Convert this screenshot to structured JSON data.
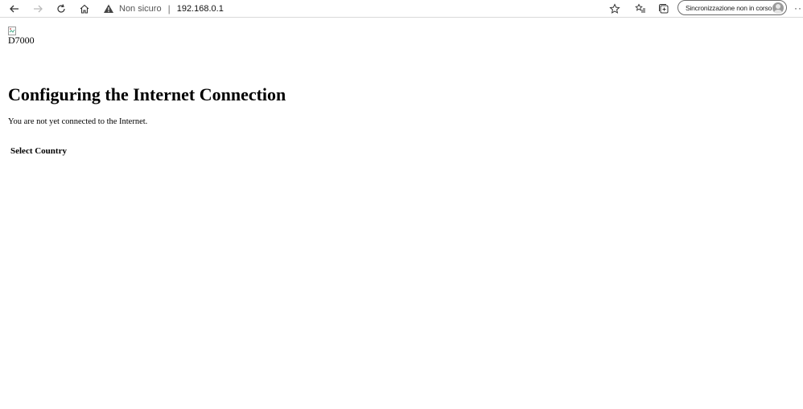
{
  "browser": {
    "security_label": "Non sicuro",
    "separator": "|",
    "url": "192.168.0.1",
    "sync_label": "Sincronizzazione non in corso",
    "more_label": "···",
    "icons": [
      "back-icon",
      "forward-icon",
      "refresh-icon",
      "home-icon",
      "warning-icon",
      "favorite-star-icon",
      "favorites-list-icon",
      "collections-icon",
      "profile-avatar-icon"
    ]
  },
  "page": {
    "logo_alt": "D7000",
    "title": "Configuring the Internet Connection",
    "status": "You are not yet connected to the Internet.",
    "section_heading": "Select Country"
  }
}
